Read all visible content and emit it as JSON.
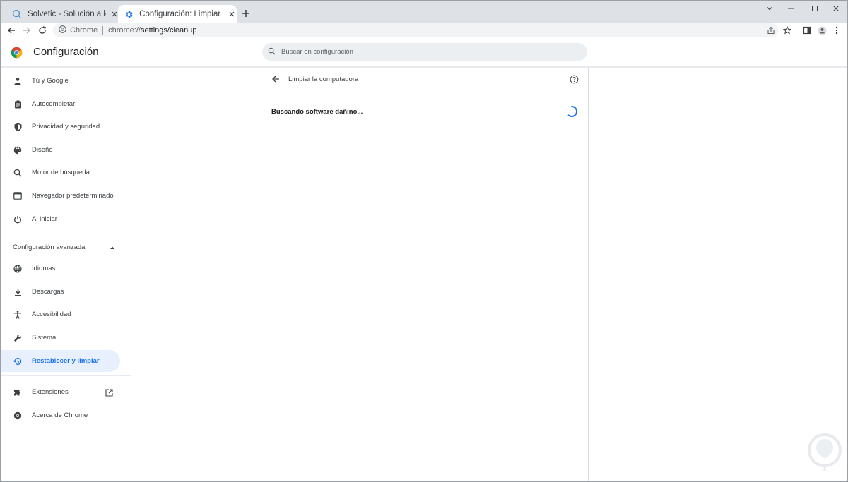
{
  "tabs": [
    {
      "title": "Solvetic - Solución a los problemas",
      "favicon": "solvetic-icon",
      "active": false
    },
    {
      "title": "Configuración: Limpiar la computadora",
      "favicon": "settings-gear-icon",
      "active": true
    }
  ],
  "toolbar": {
    "chip_label": "Chrome",
    "url_scheme": "chrome://",
    "url_rest": "settings/cleanup"
  },
  "header": {
    "title": "Configuración",
    "search_placeholder": "Buscar en configuración"
  },
  "sidebar": {
    "items": [
      {
        "label": "Tú y Google",
        "icon": "person-icon"
      },
      {
        "label": "Autocompletar",
        "icon": "clipboard-icon"
      },
      {
        "label": "Privacidad y seguridad",
        "icon": "shield-icon"
      },
      {
        "label": "Diseño",
        "icon": "palette-icon"
      },
      {
        "label": "Motor de búsqueda",
        "icon": "search-icon"
      },
      {
        "label": "Navegador predeterminado",
        "icon": "browser-icon"
      },
      {
        "label": "Al iniciar",
        "icon": "power-icon"
      }
    ],
    "advanced_label": "Configuración avanzada",
    "advanced_items": [
      {
        "label": "Idiomas",
        "icon": "globe-icon"
      },
      {
        "label": "Descargas",
        "icon": "download-icon"
      },
      {
        "label": "Accesibilidad",
        "icon": "accessibility-icon"
      },
      {
        "label": "Sistema",
        "icon": "wrench-icon"
      },
      {
        "label": "Restablecer y limpiar",
        "icon": "restore-icon",
        "active": true
      }
    ],
    "extensions_label": "Extensiones",
    "about_label": "Acerca de Chrome"
  },
  "main": {
    "card_title": "Limpiar la computadora",
    "status_text": "Buscando software dañino..."
  },
  "colors": {
    "accent": "#1a73e8",
    "active_bg": "#e8f0fe",
    "tabstrip_bg": "#dee1e6",
    "text": "#3c4043"
  }
}
